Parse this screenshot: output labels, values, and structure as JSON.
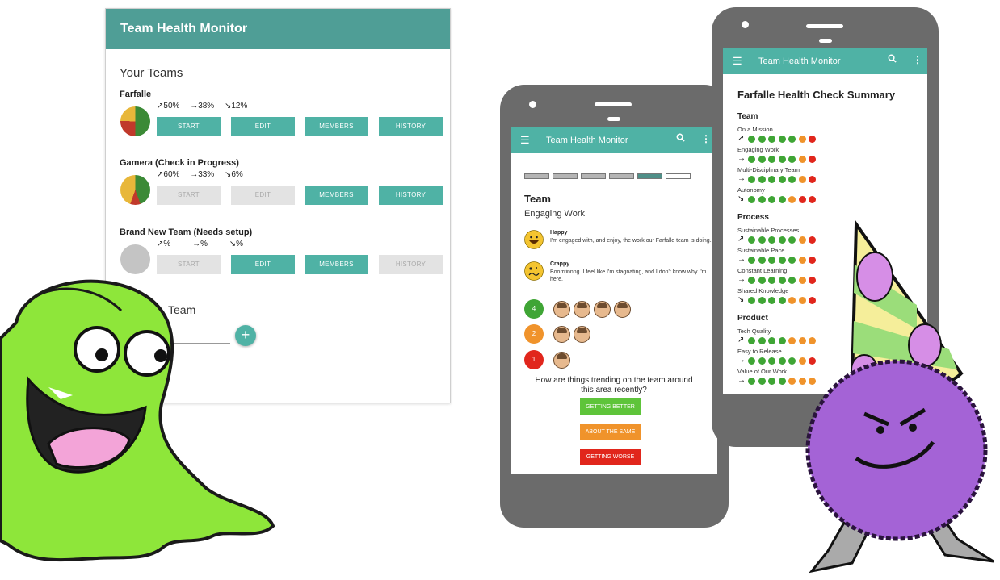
{
  "colors": {
    "header_teal": "#4f9e96",
    "button_teal": "#4fb2a5",
    "green": "#3fa535",
    "orange": "#f0932b",
    "red": "#e1261c",
    "yellow": "#e8b73a"
  },
  "desktop": {
    "title": "Team Health Monitor",
    "section_title": "Your Teams",
    "add_team_label": "Team",
    "add_button": "+",
    "teams": [
      {
        "name": "Farfalle",
        "trends": [
          "↗50%",
          "→38%",
          "↘12%"
        ],
        "buttons": [
          "START",
          "EDIT",
          "MEMBERS",
          "HISTORY"
        ]
      },
      {
        "name": "Gamera (Check in Progress)",
        "trends": [
          "↗60%",
          "→33%",
          "↘6%"
        ],
        "buttons": [
          "START",
          "EDIT",
          "MEMBERS",
          "HISTORY"
        ]
      },
      {
        "name": "Brand New Team (Needs setup)",
        "trends": [
          "↗%",
          "→%",
          "↘%"
        ],
        "buttons": [
          "START",
          "EDIT",
          "MEMBERS",
          "HISTORY"
        ]
      }
    ]
  },
  "phone1": {
    "appbar_title": "Team Health Monitor",
    "menu_icon": "hamburger-icon",
    "heading": "Team",
    "subheading": "Engaging Work",
    "progress_segments": 6,
    "progress_current": 5,
    "happy": {
      "title": "Happy",
      "desc": "I'm engaged with, and enjoy, the work our Farfalle team is doing."
    },
    "crappy": {
      "title": "Crappy",
      "desc": "Boorrrinnng. I feel like I'm stagnating, and I don't know why I'm here."
    },
    "votes": [
      {
        "count": "4",
        "avatars": 4
      },
      {
        "count": "2",
        "avatars": 2
      },
      {
        "count": "1",
        "avatars": 1
      }
    ],
    "question": "How are things trending on the team around this area recently?",
    "buttons": [
      "GETTING BETTER",
      "ABOUT THE SAME",
      "GETTING WORSE"
    ]
  },
  "phone2": {
    "appbar_title": "Team Health Monitor",
    "summary_title": "Farfalle Health Check Summary",
    "categories": [
      {
        "title": "Team",
        "metrics": [
          {
            "label": "On a Mission",
            "arrow": "↗",
            "dots": [
              "g",
              "g",
              "g",
              "g",
              "g",
              "o",
              "r"
            ]
          },
          {
            "label": "Engaging Work",
            "arrow": "→",
            "dots": [
              "g",
              "g",
              "g",
              "g",
              "g",
              "o",
              "r"
            ]
          },
          {
            "label": "Multi-Disciplinary Team",
            "arrow": "→",
            "dots": [
              "g",
              "g",
              "g",
              "g",
              "g",
              "o",
              "r"
            ]
          },
          {
            "label": "Autonomy",
            "arrow": "↘",
            "dots": [
              "g",
              "g",
              "g",
              "g",
              "o",
              "r",
              "r"
            ]
          }
        ]
      },
      {
        "title": "Process",
        "metrics": [
          {
            "label": "Sustainable Processes",
            "arrow": "↗",
            "dots": [
              "g",
              "g",
              "g",
              "g",
              "g",
              "o",
              "r"
            ]
          },
          {
            "label": "Sustainable Pace",
            "arrow": "→",
            "dots": [
              "g",
              "g",
              "g",
              "g",
              "g",
              "o",
              "r"
            ]
          },
          {
            "label": "Constant Learning",
            "arrow": "→",
            "dots": [
              "g",
              "g",
              "g",
              "g",
              "g",
              "o",
              "r"
            ]
          },
          {
            "label": "Shared Knowledge",
            "arrow": "↘",
            "dots": [
              "g",
              "g",
              "g",
              "g",
              "o",
              "o",
              "r"
            ]
          }
        ]
      },
      {
        "title": "Product",
        "metrics": [
          {
            "label": "Tech Quality",
            "arrow": "↗",
            "dots": [
              "g",
              "g",
              "g",
              "g",
              "o",
              "o",
              "o"
            ]
          },
          {
            "label": "Easy to Release",
            "arrow": "→",
            "dots": [
              "g",
              "g",
              "g",
              "g",
              "g",
              "o",
              "r"
            ]
          },
          {
            "label": "Value of Our Work",
            "arrow": "→",
            "dots": [
              "g",
              "g",
              "g",
              "g",
              "o",
              "o",
              "o"
            ]
          }
        ]
      }
    ]
  }
}
